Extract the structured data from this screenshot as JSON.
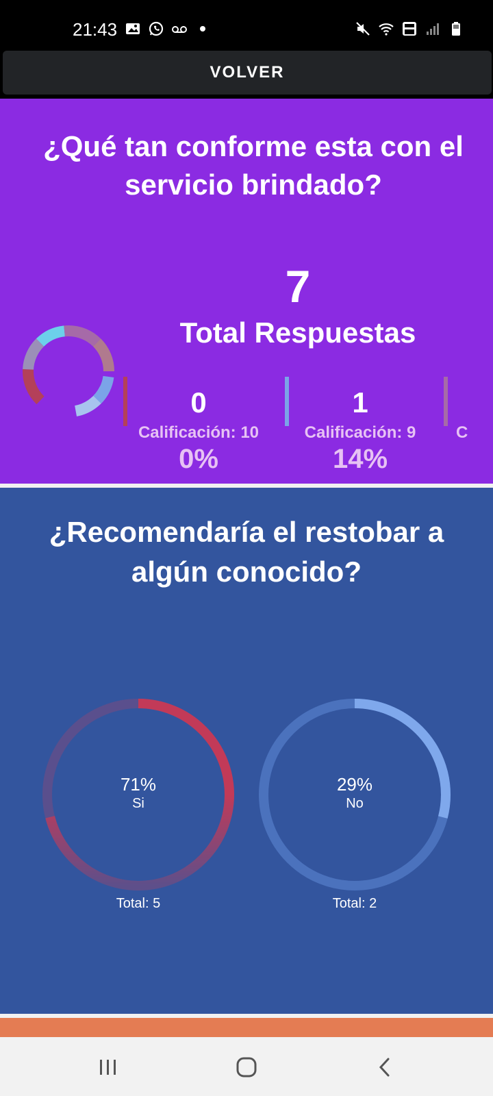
{
  "status_bar": {
    "time": "21:43",
    "left_icons": [
      "image-icon",
      "whatsapp-icon",
      "voicemail-icon",
      "dot-icon"
    ],
    "right_icons": [
      "mute-icon",
      "wifi-icon",
      "volte-4g-icon",
      "signal-icon",
      "battery-icon"
    ]
  },
  "volver": {
    "label": "VOLVER"
  },
  "survey_1": {
    "question": "¿Qué tan conforme esta con el servicio brindado?",
    "total_count": "7",
    "total_label": "Total Respuestas",
    "ratings": [
      {
        "count": "0",
        "label": "Calificación: 10",
        "percent": "0%",
        "color": "#b4405a"
      },
      {
        "count": "1",
        "label": "Calificación: 9",
        "percent": "14%",
        "color": "#7ba4e8"
      },
      {
        "count": "",
        "label": "C",
        "percent": "",
        "color": "#a66aa8"
      }
    ],
    "background": "#8b2be2"
  },
  "survey_2": {
    "question": "¿Recomendaría el restobar a algún conocido?",
    "answers": [
      {
        "percent": "71%",
        "label": "Si",
        "total": "Total: 5",
        "fraction": 0.71,
        "color": "#c23a58"
      },
      {
        "percent": "29%",
        "label": "No",
        "total": "Total: 2",
        "fraction": 0.29,
        "color": "#7fa8ec"
      }
    ],
    "background": "#33559e"
  },
  "chart_data": [
    {
      "type": "pie",
      "title": "",
      "categories": [
        "Calificación: 10",
        "Calificación: 9"
      ],
      "values": [
        0,
        1
      ],
      "note_total": 7
    },
    {
      "type": "pie",
      "title": "¿Recomendaría el restobar a algún conocido?",
      "categories": [
        "Si",
        "No"
      ],
      "values": [
        5,
        2
      ],
      "percent": [
        71,
        29
      ]
    }
  ],
  "nav": {
    "recents": "recents-icon",
    "home": "home-icon",
    "back": "back-icon"
  }
}
